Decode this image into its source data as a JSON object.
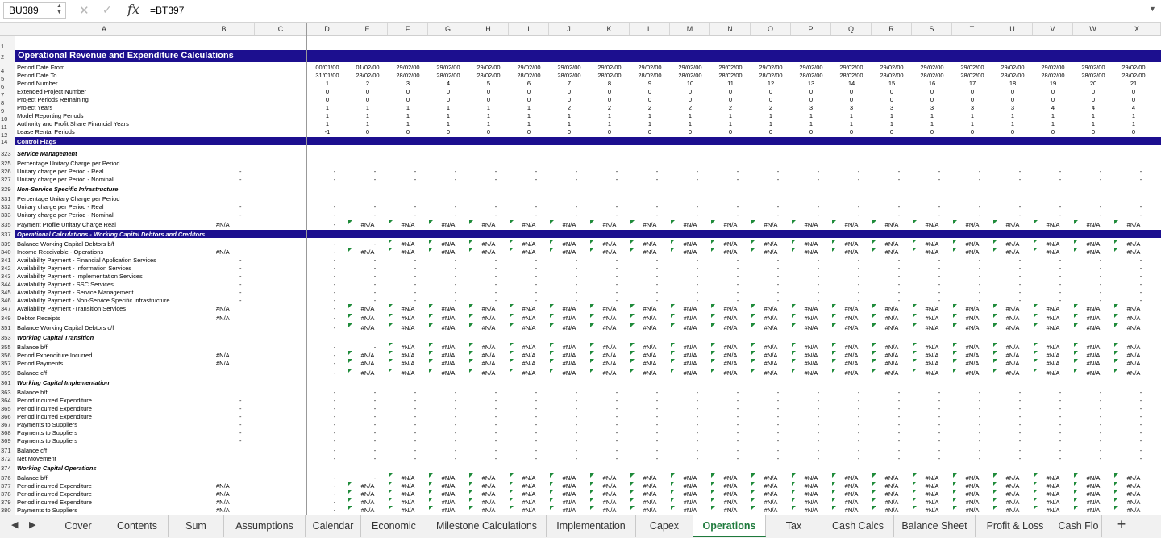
{
  "formula_bar": {
    "name_box": "BU389",
    "formula": "=BT397",
    "fx_label": "fx"
  },
  "columns": [
    "A",
    "B",
    "C",
    "D",
    "E",
    "F",
    "G",
    "H",
    "I",
    "J",
    "K",
    "L",
    "M",
    "N",
    "O",
    "P",
    "Q",
    "R",
    "S",
    "T",
    "U",
    "V",
    "W",
    "X"
  ],
  "title": "Operational Revenue and Expenditure Calculations",
  "header_rows": [
    {
      "row": "4",
      "label": "Period Date From",
      "values": [
        "00/01/00",
        "01/02/00",
        "29/02/00",
        "29/02/00",
        "29/02/00",
        "29/02/00",
        "29/02/00",
        "29/02/00",
        "29/02/00",
        "29/02/00",
        "29/02/00",
        "29/02/00",
        "29/02/00",
        "29/02/00",
        "29/02/00",
        "29/02/00",
        "29/02/00",
        "29/02/00",
        "29/02/00",
        "29/02/00",
        "29/02/00"
      ]
    },
    {
      "row": "5",
      "label": "Period Date To",
      "values": [
        "31/01/00",
        "28/02/00",
        "28/02/00",
        "28/02/00",
        "28/02/00",
        "28/02/00",
        "28/02/00",
        "28/02/00",
        "28/02/00",
        "28/02/00",
        "28/02/00",
        "28/02/00",
        "28/02/00",
        "28/02/00",
        "28/02/00",
        "28/02/00",
        "28/02/00",
        "28/02/00",
        "28/02/00",
        "28/02/00",
        "28/02/00"
      ]
    },
    {
      "row": "6",
      "label": "Period Number",
      "values": [
        "1",
        "2",
        "3",
        "4",
        "5",
        "6",
        "7",
        "8",
        "9",
        "10",
        "11",
        "12",
        "13",
        "14",
        "15",
        "16",
        "17",
        "18",
        "19",
        "20",
        "21"
      ]
    },
    {
      "row": "7",
      "label": "Extended Project Number",
      "values": [
        "0",
        "0",
        "0",
        "0",
        "0",
        "0",
        "0",
        "0",
        "0",
        "0",
        "0",
        "0",
        "0",
        "0",
        "0",
        "0",
        "0",
        "0",
        "0",
        "0",
        "0"
      ]
    },
    {
      "row": "8",
      "label": "Project Periods Remaining",
      "values": [
        "0",
        "0",
        "0",
        "0",
        "0",
        "0",
        "0",
        "0",
        "0",
        "0",
        "0",
        "0",
        "0",
        "0",
        "0",
        "0",
        "0",
        "0",
        "0",
        "0",
        "0"
      ]
    },
    {
      "row": "9",
      "label": "Project Years",
      "values": [
        "1",
        "1",
        "1",
        "1",
        "1",
        "1",
        "2",
        "2",
        "2",
        "2",
        "2",
        "2",
        "3",
        "3",
        "3",
        "3",
        "3",
        "3",
        "4",
        "4",
        "4"
      ]
    },
    {
      "row": "10",
      "label": "Model Reporting Periods",
      "values": [
        "1",
        "1",
        "1",
        "1",
        "1",
        "1",
        "1",
        "1",
        "1",
        "1",
        "1",
        "1",
        "1",
        "1",
        "1",
        "1",
        "1",
        "1",
        "1",
        "1",
        "1"
      ]
    },
    {
      "row": "11",
      "label": "Authority and Profit Share Financial Years",
      "values": [
        "1",
        "1",
        "1",
        "1",
        "1",
        "1",
        "1",
        "1",
        "1",
        "1",
        "1",
        "1",
        "1",
        "1",
        "1",
        "1",
        "1",
        "1",
        "1",
        "1",
        "1"
      ]
    },
    {
      "row": "12",
      "label": "Lease Rental Periods",
      "values": [
        "-1",
        "0",
        "0",
        "0",
        "0",
        "0",
        "0",
        "0",
        "0",
        "0",
        "0",
        "0",
        "0",
        "0",
        "0",
        "0",
        "0",
        "0",
        "0",
        "0",
        "0"
      ]
    }
  ],
  "band_labels": {
    "control_flags": "Control Flags",
    "operational_calcs": "Operational Calculations - Working Capital Debtors and Creditors"
  },
  "rows": [
    {
      "row": "323",
      "label": "Service Management",
      "sec": true
    },
    {
      "row": "325",
      "label": "Percentage Unitary Charge per Period"
    },
    {
      "row": "326",
      "label": "Unitary charge per Period - Real",
      "b": "-",
      "d": "-",
      "f": "dash"
    },
    {
      "row": "327",
      "label": "Unitary charge per Period - Nominal",
      "b": "-",
      "d": "-",
      "f": "dash"
    },
    {
      "row": "329",
      "label": "Non-Service Specific Infrastructure",
      "sec": true
    },
    {
      "row": "331",
      "label": "Percentage Unitary Charge per Period"
    },
    {
      "row": "332",
      "label": "Unitary charge per Period - Real",
      "b": "-",
      "d": "-",
      "f": "dash"
    },
    {
      "row": "333",
      "label": "Unitary charge per Period - Nominal",
      "b": "-",
      "d": "-",
      "f": "dash"
    },
    {
      "row": "335",
      "label": "Payment Profile Unitary Charge Real",
      "na": "#N/A",
      "d": "-",
      "f": "na"
    },
    {
      "row": "339",
      "label": "Balance Working Capital Debtors b/f",
      "d": "-",
      "f": "na2"
    },
    {
      "row": "340",
      "label": "Income Receivable - Operations",
      "na": "#N/A",
      "d": "-",
      "f": "na"
    },
    {
      "row": "341",
      "label": "Availability Payment - Financial Application Services",
      "b": "-",
      "d": "-",
      "f": "dash"
    },
    {
      "row": "342",
      "label": "Availability Payment - Information Services",
      "b": "-",
      "d": "-",
      "f": "dash"
    },
    {
      "row": "343",
      "label": "Availability Payment - Implementation Services",
      "b": "-",
      "d": "-",
      "f": "dash"
    },
    {
      "row": "344",
      "label": "Availability Payment - SSC Services",
      "b": "-",
      "d": "-",
      "f": "dash"
    },
    {
      "row": "345",
      "label": "Availability Payment - Service Management",
      "b": "-",
      "d": "-",
      "f": "dash"
    },
    {
      "row": "346",
      "label": "Availability Payment - Non-Service Specific Infrastructure",
      "b": "-",
      "d": "-",
      "f": "dash"
    },
    {
      "row": "347",
      "label": "Availability Payment -Transition Services",
      "na": "#N/A",
      "d": "-",
      "f": "na"
    },
    {
      "row": "349",
      "label": "Debtor Receipts",
      "na": "#N/A",
      "d": "-",
      "f": "na"
    },
    {
      "row": "351",
      "label": "Balance Working Capital Debtors c/f",
      "d": "-",
      "f": "na"
    },
    {
      "row": "353",
      "label": "Working Capital Transition",
      "sec": true
    },
    {
      "row": "355",
      "label": "Balance b/f",
      "d": "-",
      "f": "na2"
    },
    {
      "row": "356",
      "label": "Period Expenditure Incurred",
      "na": "#N/A",
      "d": "-",
      "f": "na"
    },
    {
      "row": "357",
      "label": "Period Payments",
      "na": "#N/A",
      "d": "-",
      "f": "na"
    },
    {
      "row": "359",
      "label": "Balance c/f",
      "d": "-",
      "f": "na"
    },
    {
      "row": "361",
      "label": "Working Capital Implementation",
      "sec": true
    },
    {
      "row": "363",
      "label": "Balance b/f",
      "d": "-",
      "f": "dash"
    },
    {
      "row": "364",
      "label": "Period incurred Expenditure",
      "b": "-",
      "d": "-",
      "f": "dash"
    },
    {
      "row": "365",
      "label": "Period incurred Expenditure",
      "b": "-",
      "d": "-",
      "f": "dash"
    },
    {
      "row": "366",
      "label": "Period incurred Expenditure",
      "b": "-",
      "d": "-",
      "f": "dash"
    },
    {
      "row": "367",
      "label": "Payments to Suppliers",
      "b": "-",
      "d": "-",
      "f": "dash"
    },
    {
      "row": "368",
      "label": "Payments to Suppliers",
      "b": "-",
      "d": "-",
      "f": "dash"
    },
    {
      "row": "369",
      "label": "Payments to Suppliers",
      "b": "-",
      "d": "-",
      "f": "dash"
    },
    {
      "row": "371",
      "label": "Balance c/f",
      "d": "-",
      "f": "dash"
    },
    {
      "row": "372",
      "label": "Net Movement",
      "d": "-",
      "f": "dash"
    },
    {
      "row": "374",
      "label": "Working Capital Operations",
      "sec": true
    },
    {
      "row": "376",
      "label": "Balance b/f",
      "d": "-",
      "f": "na2"
    },
    {
      "row": "377",
      "label": "Period incurred Expenditure",
      "na": "#N/A",
      "d": "-",
      "f": "na"
    },
    {
      "row": "378",
      "label": "Period incurred Expenditure",
      "na": "#N/A",
      "d": "-",
      "f": "na"
    },
    {
      "row": "379",
      "label": "Period incurred Expenditure",
      "na": "#N/A",
      "d": "-",
      "f": "na"
    },
    {
      "row": "380",
      "label": "Payments to Suppliers",
      "na": "#N/A",
      "d": "-",
      "f": "na"
    }
  ],
  "na_text": "#N/A",
  "dash_text": "-",
  "tabs": [
    "Cover",
    "Contents",
    "Sum",
    "Assumptions",
    "Calendar",
    "Economic",
    "Milestone Calculations",
    "Implementation",
    "Capex",
    "Operations",
    "Tax",
    "Cash Calcs",
    "Balance Sheet",
    "Profit & Loss",
    "Cash Flo"
  ],
  "active_tab": "Operations",
  "colors": {
    "band": "#1c0f8f",
    "active_tab": "#1e7a3c",
    "error_flag": "#1f8b3a"
  }
}
